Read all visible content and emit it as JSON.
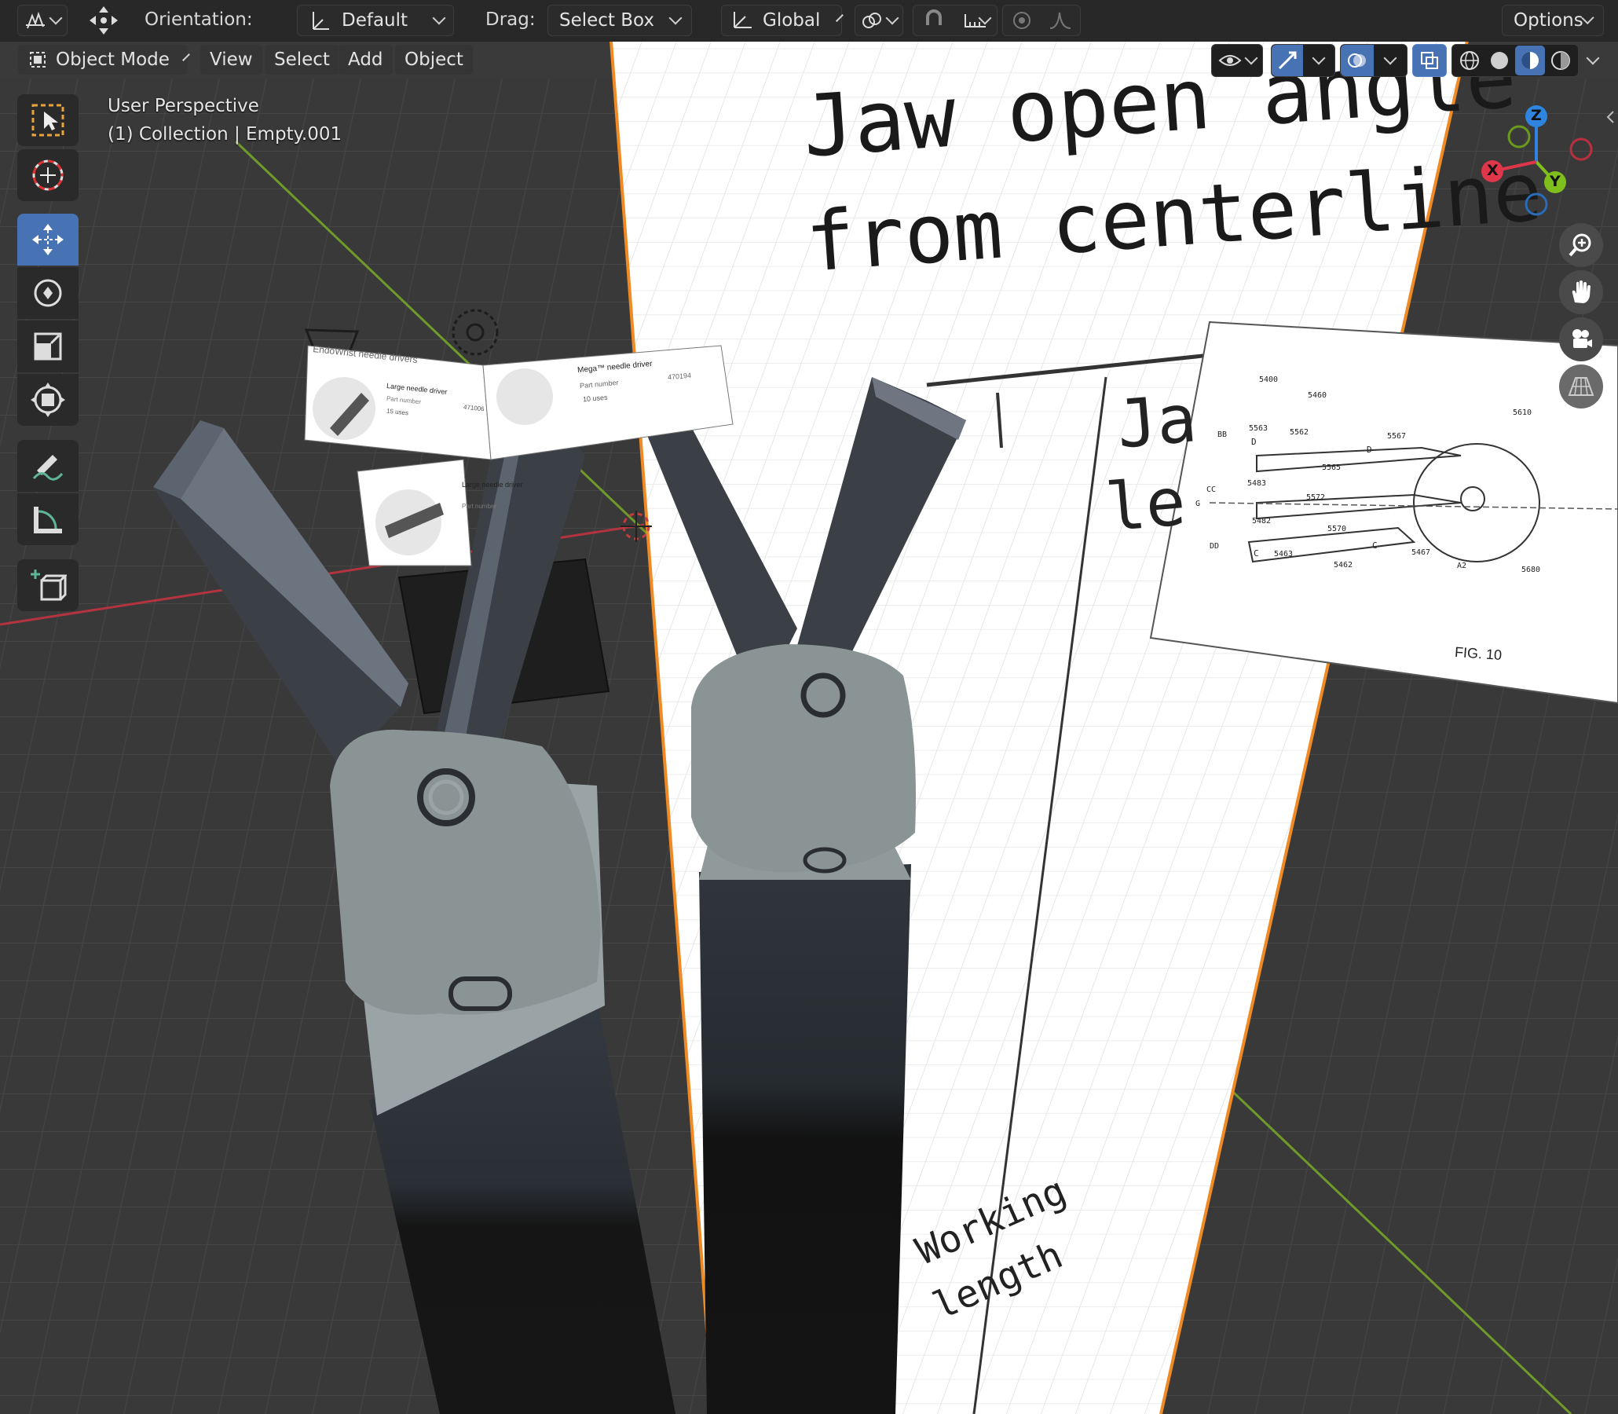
{
  "toolbar": {
    "orientation_label": "Orientation:",
    "orientation_value": "Default",
    "drag_label": "Drag:",
    "drag_value": "Select Box",
    "transform_space": "Global",
    "options_label": "Options"
  },
  "mode_bar": {
    "mode": "Object Mode",
    "menus": [
      "View",
      "Select",
      "Add",
      "Object"
    ]
  },
  "viewport": {
    "perspective": "User Perspective",
    "context": "(1) Collection | Empty.001"
  },
  "gizmo": {
    "z_label": "Z",
    "y_label": "Y",
    "x_label": "X",
    "z_color": "#2f84e0",
    "y_color": "#7fbf1d",
    "x_color": "#e0364a"
  },
  "reference_sheet": {
    "title_line1": "Jaw open angle",
    "title_line2": "from centerline",
    "fragment_1": "Ja",
    "fragment_2": "le",
    "bottom_line1": "Working",
    "bottom_line2": "length"
  },
  "patent_figure": {
    "caption": "FIG. 10",
    "labels": [
      "5400",
      "5460",
      "5610",
      "5563",
      "5562",
      "5567",
      "BB",
      "D",
      "D",
      "5565",
      "CC",
      "5483",
      "5572",
      "5482",
      "5570",
      "DD",
      "C",
      "5463",
      "5462",
      "C",
      "5467",
      "A2",
      "5680",
      "G"
    ]
  },
  "product_cards": {
    "card1_title": "EndoWrist needle drivers",
    "card1_item": "Large needle driver",
    "card1_part_label": "Part number",
    "card1_uses": "15 uses",
    "card1_part": "471006",
    "card2_title": "Mega™ needle driver",
    "card2_part_label": "Part number",
    "card2_part": "470194",
    "card2_uses": "10 uses",
    "card3_item": "Large needle driver",
    "card3_part_label": "Part number"
  },
  "colors": {
    "accent": "#4772b3",
    "viewport_bg": "#3a3a3a",
    "grid": "#4a4a4a",
    "x_axis": "#c0353f",
    "y_axis": "#7aa531",
    "selection_outline": "#f08a24"
  },
  "icons": {
    "editor_type": "viewport-editor-icon",
    "transform_pivot": "move-gizmo-icon",
    "orientation": "orientation-icon",
    "global": "global-axis-icon",
    "pivot": "pivot-point-icon",
    "snap": "snap-magnet-icon",
    "snap_increment": "snap-increment-icon",
    "proportional": "proportional-edit-icon",
    "falloff": "falloff-curve-icon"
  }
}
